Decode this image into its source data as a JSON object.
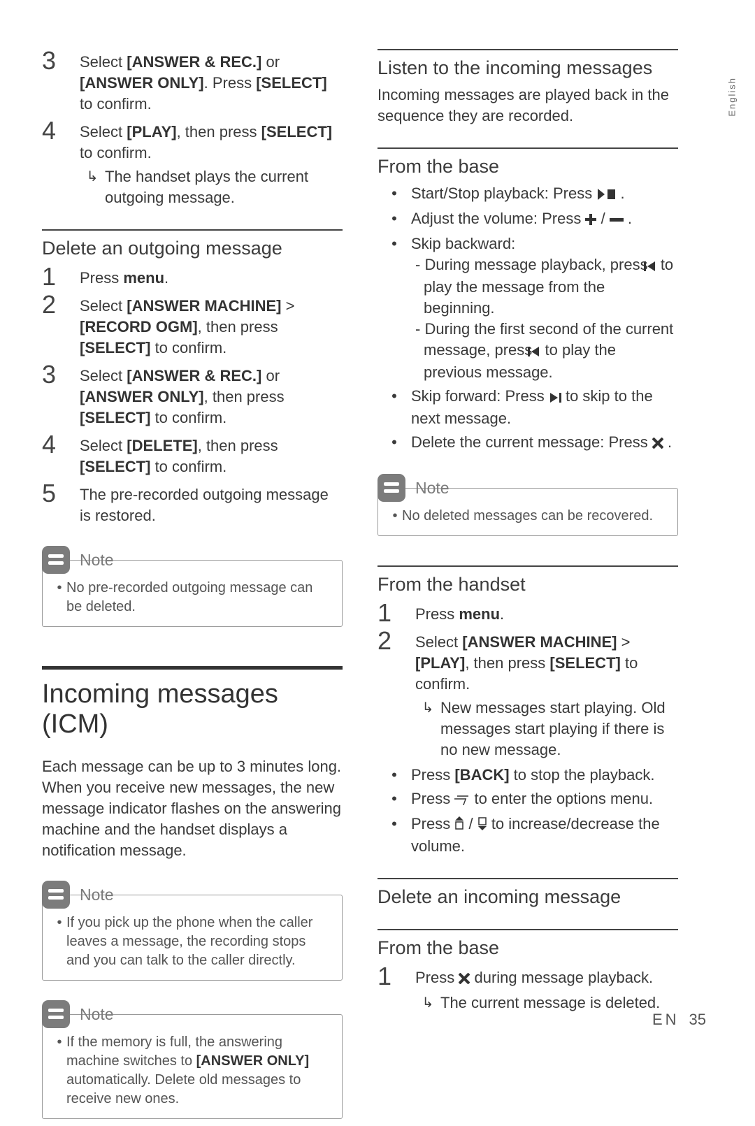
{
  "lang_tab": "English",
  "footer": {
    "lang": "EN",
    "page": "35"
  },
  "left": {
    "steps_top": [
      {
        "n": "3",
        "html_key": "l3"
      },
      {
        "n": "4",
        "html_key": "l4",
        "result_key": "l4r"
      }
    ],
    "l3": "Select [ANSWER & REC.] or [ANSWER ONLY]. Press [SELECT] to confirm.",
    "l4": "Select [PLAY], then press [SELECT] to confirm.",
    "l4r": "The handset plays the current outgoing message.",
    "del_h": "Delete an outgoing message",
    "d1": "Press menu.",
    "d2": "Select [ANSWER MACHINE] >[RECORD OGM], then press [SELECT] to confirm.",
    "d3": "Select [ANSWER & REC.] or [ANSWER ONLY], then press [SELECT] to confirm.",
    "d4": "Select [DELETE], then press [SELECT] to confirm.",
    "d5": "The pre-recorded outgoing message is restored.",
    "note_del": "No pre-recorded outgoing message can be deleted.",
    "icm_h": "Incoming messages (ICM)",
    "icm_body": "Each message can be up to 3 minutes long. When you receive new messages, the new message indicator flashes on the answering machine and the handset displays a notification message.",
    "note_icm1": "If you pick up the phone when the caller leaves a message, the recording stops and you can talk to the caller directly.",
    "note_icm2": "If the memory is full, the answering machine switches to [ANSWER ONLY] automatically. Delete old messages to receive new ones."
  },
  "right": {
    "listen_h": "Listen to the incoming messages",
    "listen_body": "Incoming messages are played back in the sequence they are recorded.",
    "base_h": "From the base",
    "b1": "Start/Stop playback: Press",
    "b2": "Adjust the volume: Press",
    "b3_lead": "Skip backward:",
    "b3a": "During message playback, press ICON to play the message from the beginning.",
    "b3b": "During the first second of the current message, press ICON to play the previous message.",
    "b4": "Skip forward: Press ICON to skip to the next message.",
    "b5": "Delete the current message: Press",
    "note_base": "No deleted messages can be recovered.",
    "handset_h": "From the handset",
    "h1": "Press menu.",
    "h2": "Select [ANSWER MACHINE] > [PLAY], then press [SELECT] to confirm.",
    "h2r": "New messages start playing. Old messages start playing if there is no new message.",
    "hb1": "Press [BACK] to stop the playback.",
    "hb2": "Press ICON to enter the options menu.",
    "hb3": "Press ICON to increase/decrease the volume.",
    "delinc_h": "Delete an incoming message",
    "base2_h": "From the base",
    "di1": "Press ICON during message playback.",
    "di1r": "The current message is deleted."
  },
  "note_label": "Note"
}
